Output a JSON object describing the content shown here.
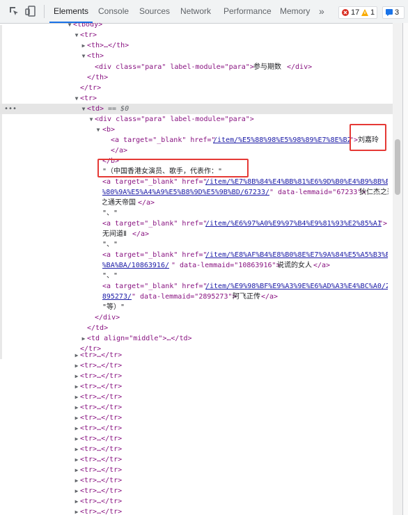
{
  "toolbar": {
    "tabs": [
      "Elements",
      "Console",
      "Sources",
      "Network",
      "Performance",
      "Memory"
    ],
    "more_tabs": "»",
    "error_count": "17",
    "warning_count": "1",
    "message_count": "3",
    "icons": [
      "inspect-element-icon",
      "device-toolbar-icon",
      "error-icon",
      "warning-icon",
      "message-icon"
    ]
  },
  "dom": {
    "l0": "<tbody>",
    "l1": "<tr>",
    "l2": "<th>…</th>",
    "l3": "<th>",
    "l4_div": "<div class=\"para\" label-module=\"para\">",
    "l4_text": "参与期数",
    "l4_close": "</div>",
    "l5": "</th>",
    "l6": "</tr>",
    "l7": "<tr>",
    "l8_td": "<td>",
    "l8_eq": "== $0",
    "l9": "<div class=\"para\" label-module=\"para\">",
    "l10": "<b>",
    "l11_a": "<a target=\"_blank\" href=\"",
    "l11_href": "/item/%E5%88%98%E5%98%89%E7%8E%B2",
    "l11_close": "\">",
    "l11_text": "刘嘉玲",
    "l12": "</a>",
    "l13": "</b>",
    "l14": "\"（中国香港女演员、歌手，代表作：\"",
    "l15_a": "<a target=\"_blank\" href=\"",
    "l15_href": "/item/%E7%8B%84%E4%BB%81%E6%9D%B0%E4%B9%8B%E9%80%9A%E5%A4%A9%E5%B8%9D%E5%9B%BD/67233",
    "l15_mid": "\" data-lemmaid=\"67233\">",
    "l15_text": "狄仁杰之通天帝国",
    "l15_close": "</a>",
    "l16": "\"、\"",
    "l17_a": "<a target=\"_blank\" href=\"",
    "l17_href": "/item/%E6%97%A0%E9%97%B4%E9%81%93%E2%85%A1",
    "l17_close": "\">",
    "l17_text": "无间道Ⅱ",
    "l17_end": "</a>",
    "l18": "\"、\"",
    "l19_a": "<a target=\"_blank\" href=\"",
    "l19_href": "/item/%E8%AF%B4%E8%B0%8E%E7%9A%84%E5%A5%B3%E4%BA%BA/10863916",
    "l19_mid": "\" data-lemmaid=\"10863916\">",
    "l19_text": "说谎的女人",
    "l19_close": "</a>",
    "l20": "\"、\"",
    "l21_a": "<a target=\"_blank\" href=\"",
    "l21_href": "/item/%E9%98%BF%E9%A3%9E%E6%AD%A3%E4%BC%A0/2895273",
    "l21_mid": "\" data-lemmaid=\"2895273\">",
    "l21_text": "阿飞正传",
    "l21_close": "</a>",
    "l22": "\"等）\"",
    "l23": "</div>",
    "l24": "</td>",
    "l25": "<td align=\"middle\">…</td>",
    "l26": "</tr>",
    "collapsed_tr": "<tr>…</tr>"
  }
}
